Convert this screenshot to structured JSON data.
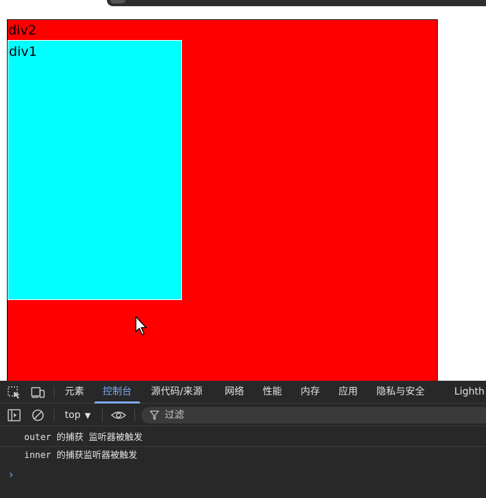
{
  "page": {
    "div2_label": "div2",
    "div1_label": "div1",
    "colors": {
      "div2": "#ff0000",
      "div1": "#00ffff"
    }
  },
  "devtools": {
    "tabs": [
      {
        "label": "元素"
      },
      {
        "label": "控制台",
        "active": true
      },
      {
        "label": "源代码/来源"
      },
      {
        "label": "网络"
      },
      {
        "label": "性能"
      },
      {
        "label": "内存"
      },
      {
        "label": "应用"
      },
      {
        "label": "隐私与安全"
      },
      {
        "label": "Lighth"
      }
    ],
    "toolbar": {
      "context": "top",
      "filter_placeholder": "过滤"
    },
    "console_lines": [
      "outer 的捕获 监听器被触发",
      "inner 的捕获监听器被触发"
    ],
    "prompt": "›"
  }
}
